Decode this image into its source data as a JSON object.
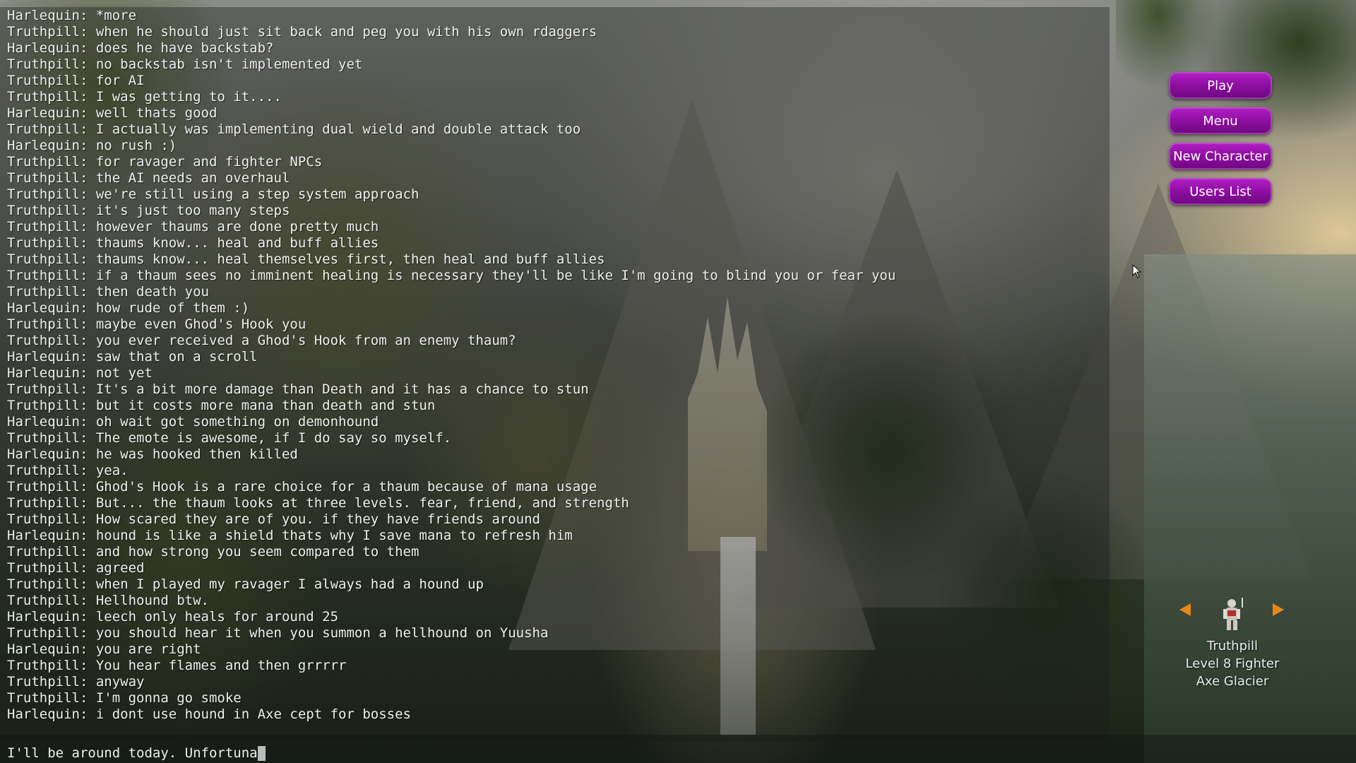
{
  "chat": {
    "lines": [
      {
        "speaker": "Harlequin",
        "text": "*more"
      },
      {
        "speaker": "Truthpill",
        "text": "when he should just sit back and peg you with his own rdaggers"
      },
      {
        "speaker": "Harlequin",
        "text": "does he have backstab?"
      },
      {
        "speaker": "Truthpill",
        "text": "no backstab isn't implemented yet"
      },
      {
        "speaker": "Truthpill",
        "text": "for AI"
      },
      {
        "speaker": "Truthpill",
        "text": "I was getting to it...."
      },
      {
        "speaker": "Harlequin",
        "text": "well thats good"
      },
      {
        "speaker": "Truthpill",
        "text": "I actually was implementing dual wield and double attack too"
      },
      {
        "speaker": "Harlequin",
        "text": "no rush :)"
      },
      {
        "speaker": "Truthpill",
        "text": "for ravager and fighter NPCs"
      },
      {
        "speaker": "Truthpill",
        "text": "the AI needs an overhaul"
      },
      {
        "speaker": "Truthpill",
        "text": "we're still using a step system approach"
      },
      {
        "speaker": "Truthpill",
        "text": "it's just too many steps"
      },
      {
        "speaker": "Truthpill",
        "text": "however thaums are done pretty much"
      },
      {
        "speaker": "Truthpill",
        "text": "thaums know... heal and buff allies"
      },
      {
        "speaker": "Truthpill",
        "text": "thaums know... heal themselves first, then heal and buff allies"
      },
      {
        "speaker": "Truthpill",
        "text": "if a thaum sees no imminent healing is necessary they'll be like I'm going to blind you or fear you"
      },
      {
        "speaker": "Truthpill",
        "text": "then death you"
      },
      {
        "speaker": "Harlequin",
        "text": "how rude of them :)"
      },
      {
        "speaker": "Truthpill",
        "text": "maybe even Ghod's Hook you"
      },
      {
        "speaker": "Truthpill",
        "text": "you ever received a Ghod's Hook from an enemy thaum?"
      },
      {
        "speaker": "Harlequin",
        "text": "saw that on a scroll"
      },
      {
        "speaker": "Harlequin",
        "text": "not yet"
      },
      {
        "speaker": "Truthpill",
        "text": "It's a bit more damage than Death and it has a chance to stun"
      },
      {
        "speaker": "Truthpill",
        "text": "but it costs more mana than death and stun"
      },
      {
        "speaker": "Harlequin",
        "text": "oh wait got something on demonhound"
      },
      {
        "speaker": "Truthpill",
        "text": "The emote is awesome, if I do say so myself."
      },
      {
        "speaker": "Harlequin",
        "text": "he was hooked then killed"
      },
      {
        "speaker": "Truthpill",
        "text": "yea."
      },
      {
        "speaker": "Truthpill",
        "text": "Ghod's Hook is a rare choice for a thaum because of mana usage"
      },
      {
        "speaker": "Truthpill",
        "text": "But... the thaum looks at three levels. fear, friend, and strength"
      },
      {
        "speaker": "Truthpill",
        "text": "How scared they are of you. if they have friends around"
      },
      {
        "speaker": "Harlequin",
        "text": "hound is like a shield thats why I save mana to refresh him"
      },
      {
        "speaker": "Truthpill",
        "text": "and how strong you seem compared to them"
      },
      {
        "speaker": "Truthpill",
        "text": "agreed"
      },
      {
        "speaker": "Truthpill",
        "text": "when I played my ravager I always had a hound up"
      },
      {
        "speaker": "Truthpill",
        "text": "Hellhound btw."
      },
      {
        "speaker": "Harlequin",
        "text": "leech only heals for around 25"
      },
      {
        "speaker": "Truthpill",
        "text": "you should hear it when you summon a hellhound on Yuusha"
      },
      {
        "speaker": "Harlequin",
        "text": "you are right"
      },
      {
        "speaker": "Truthpill",
        "text": "You hear flames and then grrrrr"
      },
      {
        "speaker": "Truthpill",
        "text": "anyway"
      },
      {
        "speaker": "Truthpill",
        "text": "I'm gonna go smoke"
      },
      {
        "speaker": "Harlequin",
        "text": "i dont use hound in Axe cept for bosses"
      }
    ],
    "input_value": "I'll be around today. Unfortuna"
  },
  "menu": {
    "play": "Play",
    "menu": "Menu",
    "new_character": "New Character",
    "users_list": "Users List"
  },
  "character": {
    "name": "Truthpill",
    "class_line": "Level 8 Fighter",
    "location": "Axe Glacier"
  },
  "colors": {
    "button_purple": "#8a0d9c",
    "arrow_orange": "#e8861a",
    "chat_text": "#eef0ee"
  },
  "icons": {
    "prev": "arrow-left-icon",
    "next": "arrow-right-icon",
    "avatar": "character-sprite",
    "cursor": "mouse-cursor-icon"
  }
}
